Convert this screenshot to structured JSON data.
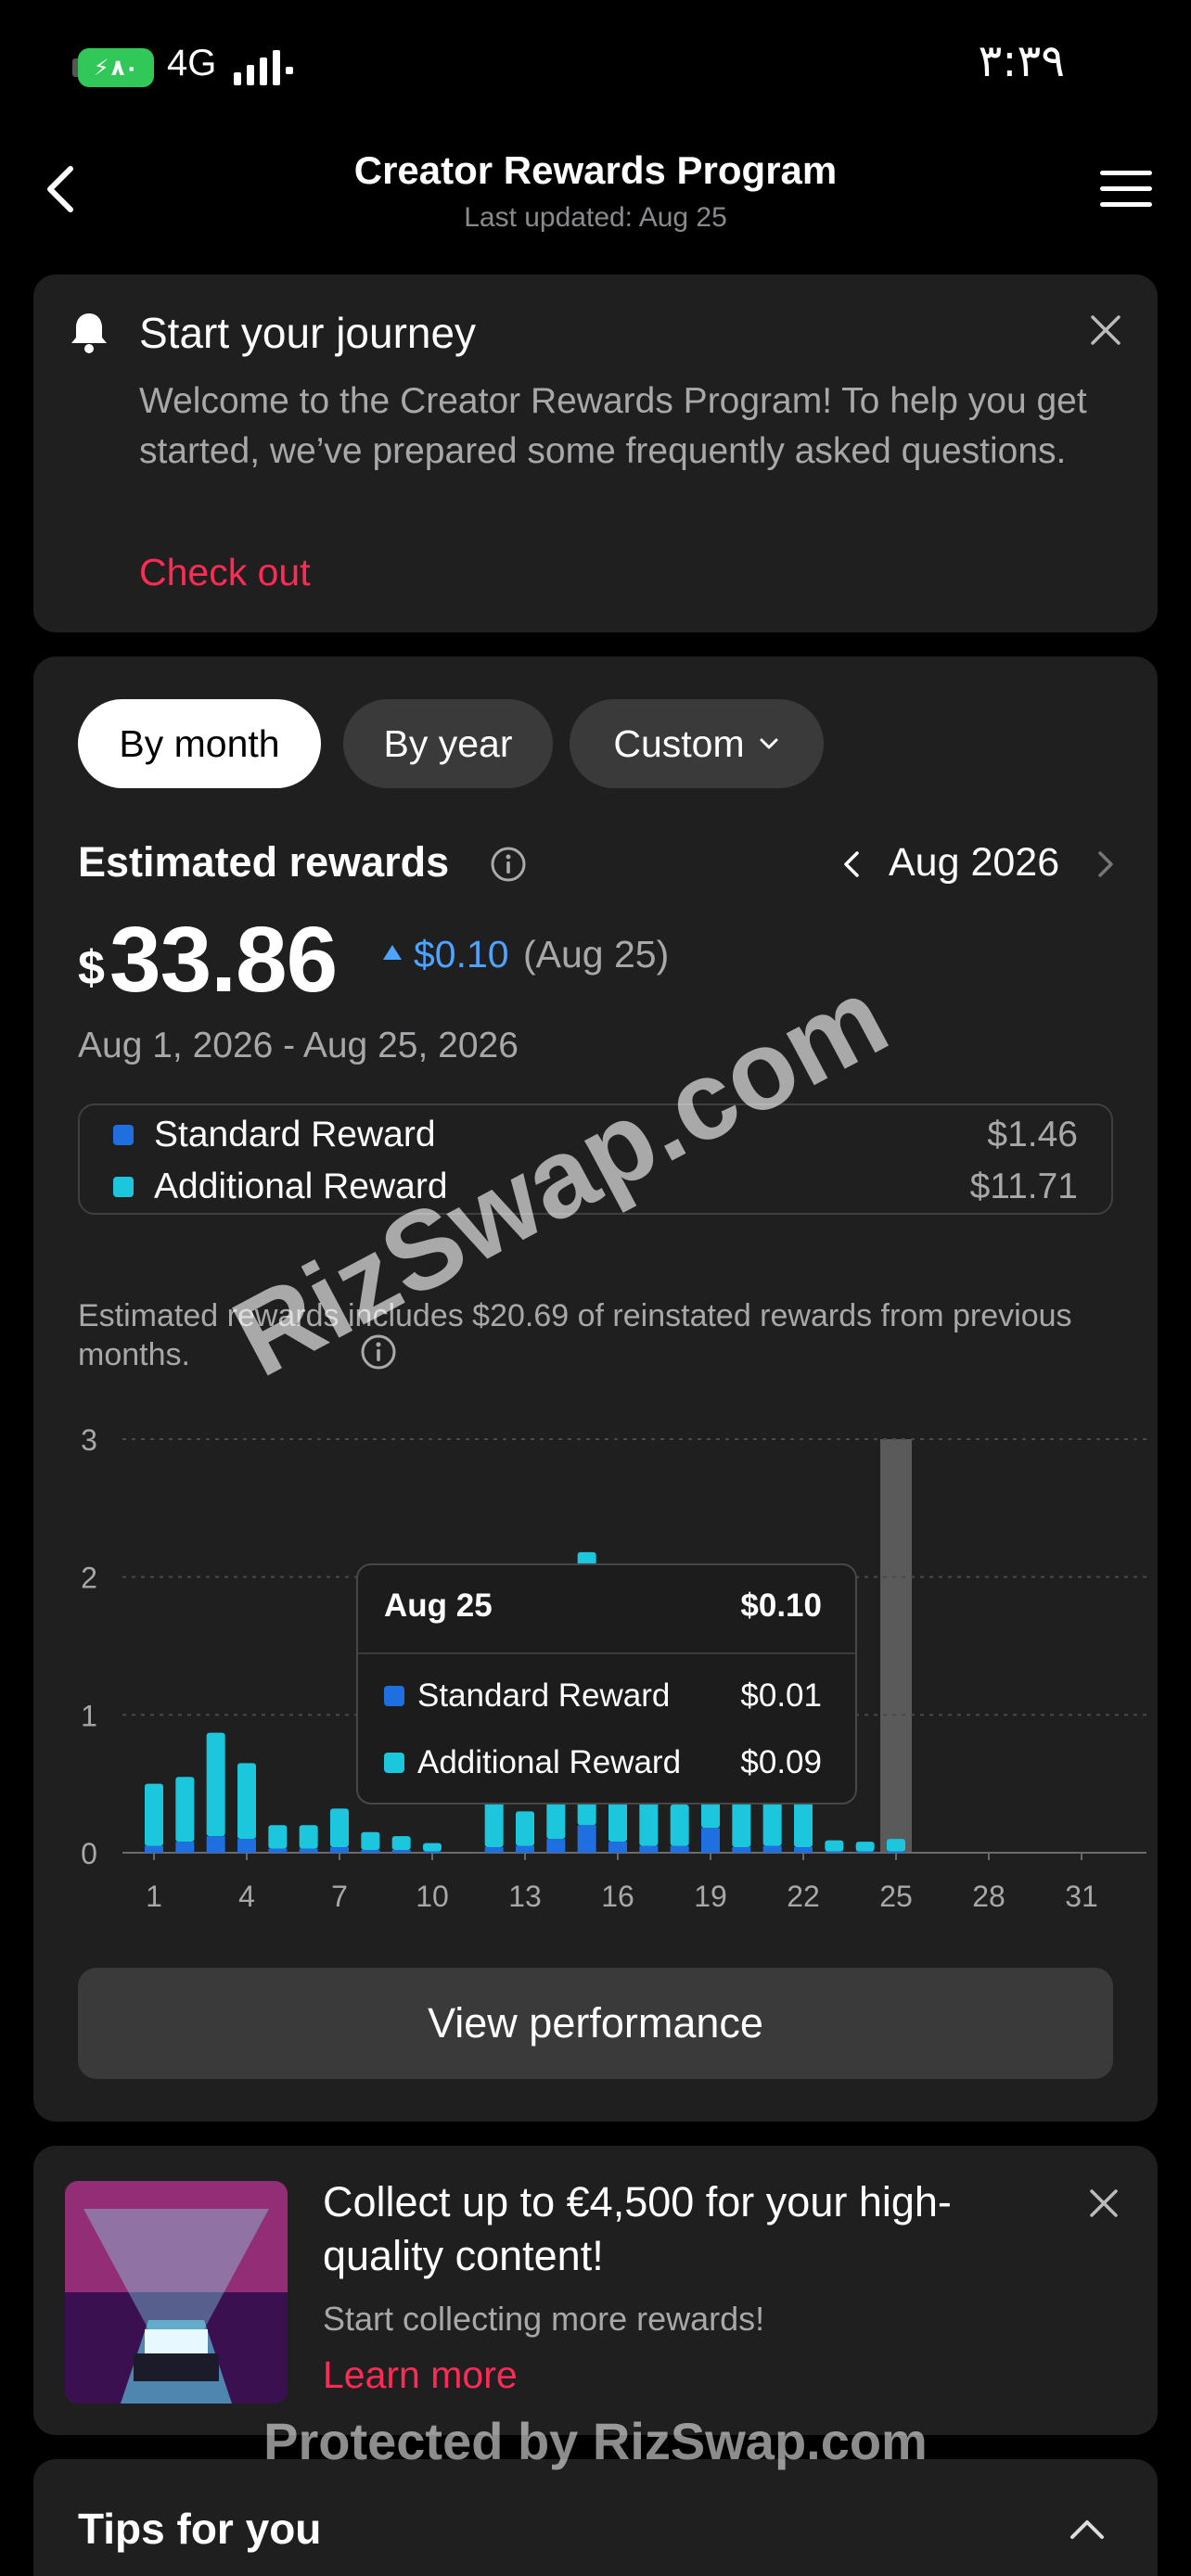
{
  "status_bar": {
    "battery_text": "٨٠",
    "network": "4G",
    "time": "٣:٣٩"
  },
  "header": {
    "title": "Creator Rewards Program",
    "subtitle": "Last updated: Aug 25"
  },
  "journey": {
    "title": "Start your journey",
    "body": "Welcome to the Creator Rewards Program! To help you get started, we’ve prepared some frequently asked questions.",
    "link": "Check out"
  },
  "rewards": {
    "tabs": {
      "month": "By month",
      "year": "By year",
      "custom": "Custom"
    },
    "title": "Estimated rewards",
    "period": "Aug 2026",
    "currency_symbol": "$",
    "amount": "33.86",
    "delta": "$0.10",
    "delta_date": "(Aug 25)",
    "date_range": "Aug 1, 2026 - Aug 25, 2026",
    "legend": [
      {
        "name": "Standard Reward",
        "value": "$1.46"
      },
      {
        "name": "Additional Reward",
        "value": "$11.71"
      }
    ],
    "note": "Estimated rewards includes $20.69 of reinstated rewards from previous months.",
    "tooltip": {
      "date": "Aug 25",
      "total": "$0.10",
      "rows": [
        {
          "name": "Standard Reward",
          "value": "$0.01"
        },
        {
          "name": "Additional Reward",
          "value": "$0.09"
        }
      ]
    },
    "button": "View performance"
  },
  "colors": {
    "standard": "#1f6fe0",
    "additional": "#1cc6dc",
    "accent_red": "#fe2c55",
    "accent_blue": "#4ea3ff",
    "highlight": "#5a5a5a"
  },
  "chart_data": {
    "type": "bar",
    "stacked": true,
    "x_ticks": [
      "1",
      "4",
      "7",
      "10",
      "13",
      "16",
      "19",
      "22",
      "25",
      "28",
      "31"
    ],
    "y_ticks": [
      "0",
      "1",
      "2",
      "3"
    ],
    "ylim": [
      0,
      3
    ],
    "grid": true,
    "days": [
      1,
      2,
      3,
      4,
      5,
      6,
      7,
      8,
      9,
      10,
      11,
      12,
      13,
      14,
      15,
      16,
      17,
      18,
      19,
      20,
      21,
      22,
      23,
      24,
      25
    ],
    "series": [
      {
        "name": "Standard Reward",
        "color": "#1f6fe0",
        "values": [
          0.05,
          0.08,
          0.12,
          0.1,
          0.03,
          0.03,
          0.04,
          0.02,
          0.02,
          0.01,
          0.0,
          0.04,
          0.05,
          0.1,
          0.2,
          0.08,
          0.05,
          0.05,
          0.18,
          0.04,
          0.05,
          0.04,
          0.01,
          0.01,
          0.01
        ]
      },
      {
        "name": "Additional Reward",
        "color": "#1cc6dc",
        "values": [
          0.45,
          0.47,
          0.75,
          0.55,
          0.17,
          0.17,
          0.28,
          0.13,
          0.1,
          0.06,
          0.0,
          0.36,
          0.25,
          0.5,
          1.98,
          0.32,
          0.35,
          0.3,
          0.22,
          0.36,
          0.4,
          0.36,
          0.08,
          0.07,
          0.09
        ]
      }
    ],
    "highlight_day": 25
  },
  "promo": {
    "title": "Collect up to €4,500 for your high-quality content!",
    "subtitle": "Start collecting more rewards!",
    "link": "Learn more"
  },
  "tips": {
    "title": "Tips for you"
  },
  "watermarks": {
    "center": "RizSwap.com",
    "bottom": "Protected by RizSwap.com"
  }
}
